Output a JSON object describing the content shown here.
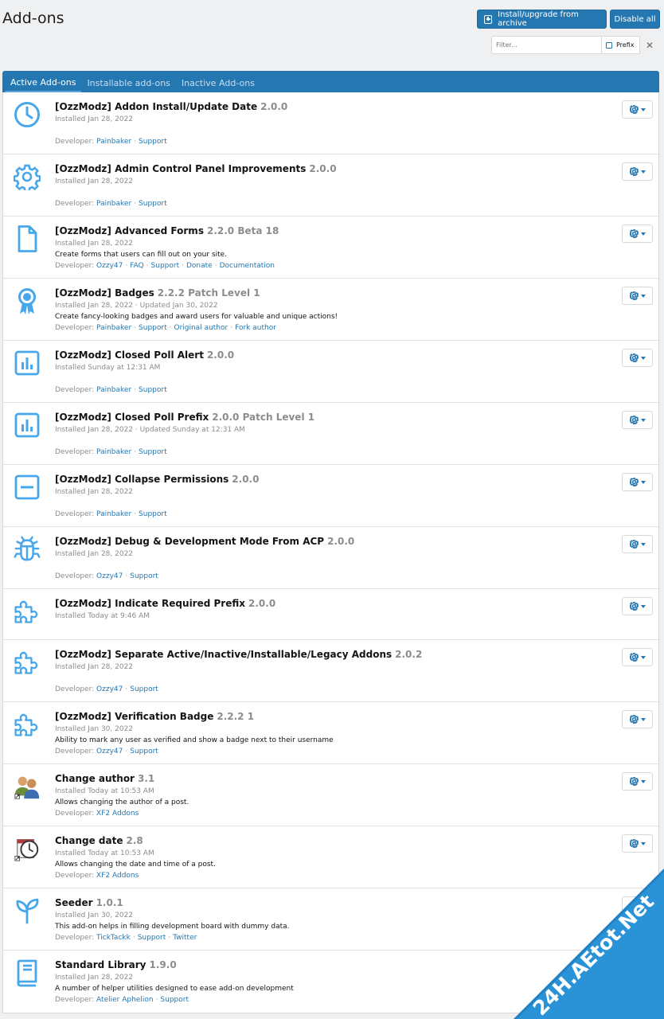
{
  "page": {
    "title": "Add-ons"
  },
  "actions": {
    "install_label": "Install/upgrade from archive",
    "disable_label": "Disable all"
  },
  "filter": {
    "placeholder": "Filter...",
    "prefix_label": "Prefix",
    "clear_glyph": "✕"
  },
  "tabs": [
    {
      "label": "Active Add-ons",
      "active": true
    },
    {
      "label": "Installable add-ons",
      "active": false
    },
    {
      "label": "Inactive Add-ons",
      "active": false
    }
  ],
  "addons": [
    {
      "title": "[OzzModz] Addon Install/Update Date",
      "version": "2.0.0",
      "installed": "Installed Jan 28, 2022",
      "description": "",
      "dev_label": "Developer:",
      "links": [
        "Painbaker",
        "Support"
      ],
      "icon": "clock-icon"
    },
    {
      "title": "[OzzModz] Admin Control Panel Improvements",
      "version": "2.0.0",
      "installed": "Installed Jan 28, 2022",
      "description": "",
      "dev_label": "Developer:",
      "links": [
        "Painbaker",
        "Support"
      ],
      "icon": "gear-icon"
    },
    {
      "title": "[OzzModz] Advanced Forms",
      "version": "2.2.0 Beta 18",
      "installed": "Installed Jan 28, 2022",
      "description": "Create forms that users can fill out on your site.",
      "dev_label": "Developer:",
      "links": [
        "Ozzy47",
        "FAQ",
        "Support",
        "Donate",
        "Documentation"
      ],
      "icon": "file-icon"
    },
    {
      "title": "[OzzModz] Badges",
      "version": "2.2.2 Patch Level 1",
      "installed": "Installed Jan 28, 2022 · Updated Jan 30, 2022",
      "description": "Create fancy-looking badges and award users for valuable and unique actions!",
      "dev_label": "Developer:",
      "links": [
        "Painbaker",
        "Support",
        "Original author",
        "Fork author"
      ],
      "icon": "award-icon"
    },
    {
      "title": "[OzzModz] Closed Poll Alert",
      "version": "2.0.0",
      "installed": "Installed Sunday at 12:31 AM",
      "description": "",
      "dev_label": "Developer:",
      "links": [
        "Painbaker",
        "Support"
      ],
      "icon": "poll-icon"
    },
    {
      "title": "[OzzModz] Closed Poll Prefix",
      "version": "2.0.0 Patch Level 1",
      "installed": "Installed Jan 28, 2022 · Updated Sunday at 12:31 AM",
      "description": "",
      "dev_label": "Developer:",
      "links": [
        "Painbaker",
        "Support"
      ],
      "icon": "poll-icon"
    },
    {
      "title": "[OzzModz] Collapse Permissions",
      "version": "2.0.0",
      "installed": "Installed Jan 28, 2022",
      "description": "",
      "dev_label": "Developer:",
      "links": [
        "Painbaker",
        "Support"
      ],
      "icon": "minus-square-icon"
    },
    {
      "title": "[OzzModz] Debug & Development Mode From ACP",
      "version": "2.0.0",
      "installed": "Installed Jan 28, 2022",
      "description": "",
      "dev_label": "Developer:",
      "links": [
        "Ozzy47",
        "Support"
      ],
      "icon": "bug-icon"
    },
    {
      "title": "[OzzModz] Indicate Required Prefix",
      "version": "2.0.0",
      "installed": "Installed Today at 9:46 AM",
      "description": "",
      "dev_label": "",
      "links": [],
      "icon": "puzzle-icon"
    },
    {
      "title": "[OzzModz] Separate Active/Inactive/Installable/Legacy Addons",
      "version": "2.0.2",
      "installed": "Installed Jan 28, 2022",
      "description": "",
      "dev_label": "Developer:",
      "links": [
        "Ozzy47",
        "Support"
      ],
      "icon": "puzzle-icon"
    },
    {
      "title": "[OzzModz] Verification Badge",
      "version": "2.2.2 1",
      "installed": "Installed Jan 30, 2022",
      "description": "Ability to mark any user as verified and show a badge next to their username",
      "dev_label": "Developer:",
      "links": [
        "Ozzy47",
        "Support"
      ],
      "icon": "puzzle-icon"
    },
    {
      "title": "Change author",
      "version": "3.1",
      "installed": "Installed Today at 10:53 AM",
      "description": "Allows changing the author of a post.",
      "dev_label": "Developer:",
      "links": [
        "XF2 Addons"
      ],
      "icon": "users-icon"
    },
    {
      "title": "Change date",
      "version": "2.8",
      "installed": "Installed Today at 10:53 AM",
      "description": "Allows changing the date and time of a post.",
      "dev_label": "Developer:",
      "links": [
        "XF2 Addons"
      ],
      "icon": "calendar-clock-icon"
    },
    {
      "title": "Seeder",
      "version": "1.0.1",
      "installed": "Installed Jan 30, 2022",
      "description": "This add-on helps in filling development board with dummy data.",
      "dev_label": "Developer:",
      "links": [
        "TickTackk",
        "Support",
        "Twitter"
      ],
      "icon": "seedling-icon"
    },
    {
      "title": "Standard Library",
      "version": "1.9.0",
      "installed": "Installed Jan 28, 2022",
      "description": "A number of helper utilities designed to ease add-on development",
      "dev_label": "Developer:",
      "links": [
        "Atelier Aphelion",
        "Support"
      ],
      "icon": "book-icon"
    }
  ],
  "watermark": {
    "text": "24H.AEtot.Net"
  },
  "colors": {
    "accent": "#2577b1",
    "icon_blue": "#47a7eb"
  }
}
